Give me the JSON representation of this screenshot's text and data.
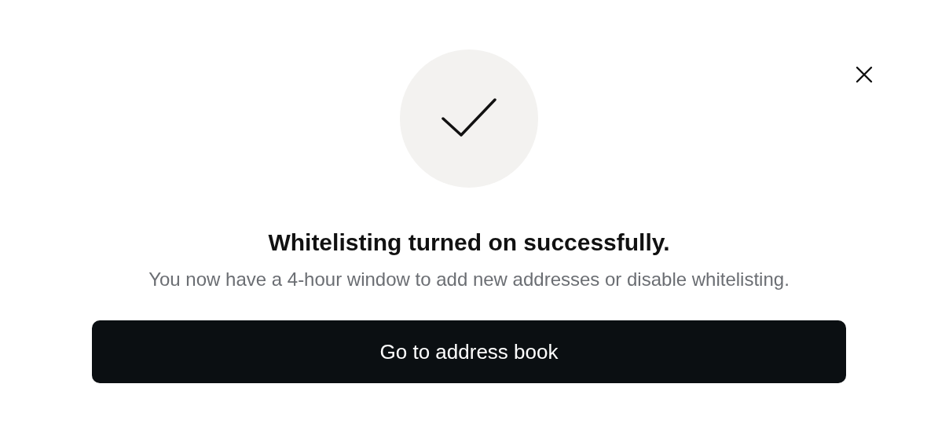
{
  "dialog": {
    "title": "Whitelisting turned on successfully.",
    "message": "You now have a 4-hour window to add new addresses or disable whitelisting.",
    "button": "Go to address book"
  }
}
